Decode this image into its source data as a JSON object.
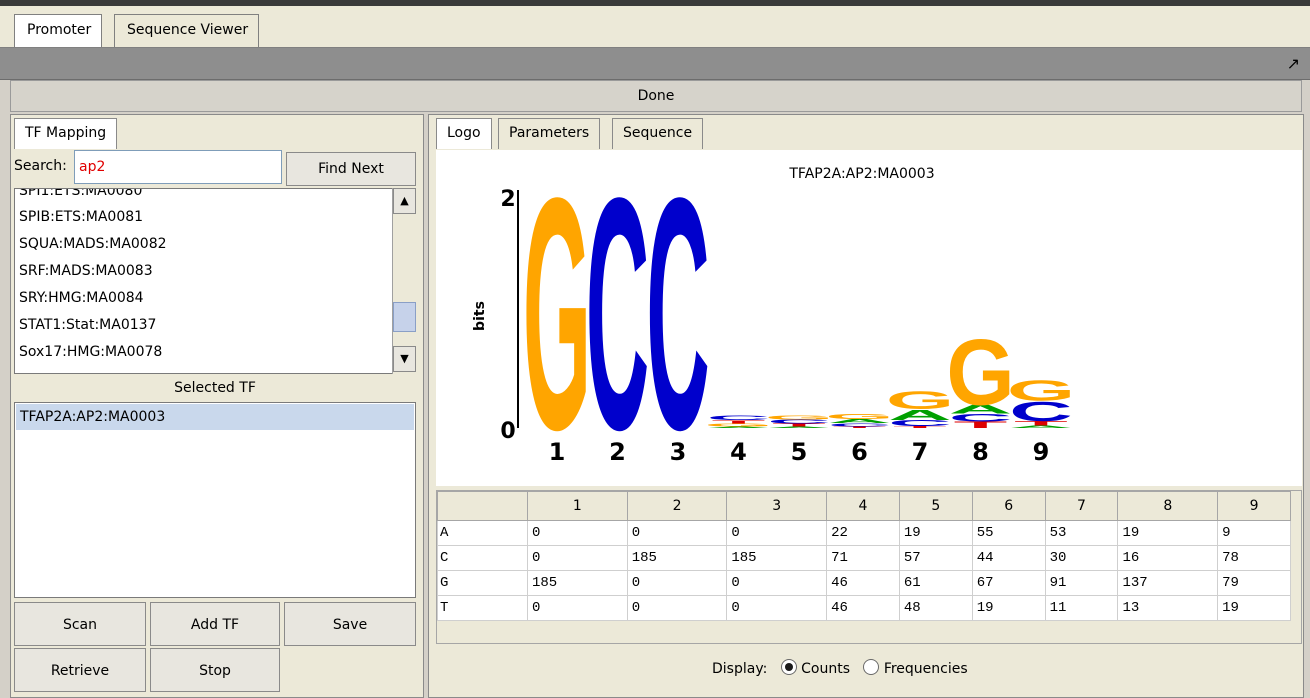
{
  "tabs": [
    {
      "label": "Promoter"
    },
    {
      "label": "Sequence Viewer"
    }
  ],
  "status": {
    "done_label": "Done"
  },
  "left_panel": {
    "tab_label": "TF Mapping",
    "search_label": "Search:",
    "search_value": "ap2",
    "find_next_label": "Find Next",
    "tf_list": [
      "SPI1:ETS:MA0080",
      "SPIB:ETS:MA0081",
      "SQUA:MADS:MA0082",
      "SRF:MADS:MA0083",
      "SRY:HMG:MA0084",
      "STAT1:Stat:MA0137",
      "Sox17:HMG:MA0078"
    ],
    "selected_header": "Selected TF",
    "selected_items": [
      "TFAP2A:AP2:MA0003"
    ],
    "buttons": {
      "scan": "Scan",
      "add_tf": "Add TF",
      "save": "Save",
      "retrieve": "Retrieve",
      "stop": "Stop"
    }
  },
  "right_panel": {
    "tabs": [
      {
        "label": "Logo"
      },
      {
        "label": "Parameters"
      },
      {
        "label": "Sequence"
      }
    ],
    "logo": {
      "title": "TFAP2A:AP2:MA0003",
      "ylabel": "bits",
      "y_ticks": [
        "2",
        "0"
      ],
      "positions": [
        "1",
        "2",
        "3",
        "4",
        "5",
        "6",
        "7",
        "8",
        "9"
      ],
      "colors": {
        "A": "#00a000",
        "C": "#0000cc",
        "G": "#ffa500",
        "T": "#dd0000"
      }
    },
    "matrix": {
      "columns": [
        "1",
        "2",
        "3",
        "4",
        "5",
        "6",
        "7",
        "8",
        "9"
      ],
      "rows": [
        {
          "label": "A",
          "values": [
            "0",
            "0",
            "0",
            "22",
            "19",
            "55",
            "53",
            "19",
            "9"
          ]
        },
        {
          "label": "C",
          "values": [
            "0",
            "185",
            "185",
            "71",
            "57",
            "44",
            "30",
            "16",
            "78"
          ]
        },
        {
          "label": "G",
          "values": [
            "185",
            "0",
            "0",
            "46",
            "61",
            "67",
            "91",
            "137",
            "79"
          ]
        },
        {
          "label": "T",
          "values": [
            "0",
            "0",
            "0",
            "46",
            "48",
            "19",
            "11",
            "13",
            "19"
          ]
        }
      ]
    },
    "display": {
      "label": "Display:",
      "counts_label": "Counts",
      "frequencies_label": "Frequencies",
      "selected": "Counts"
    }
  }
}
